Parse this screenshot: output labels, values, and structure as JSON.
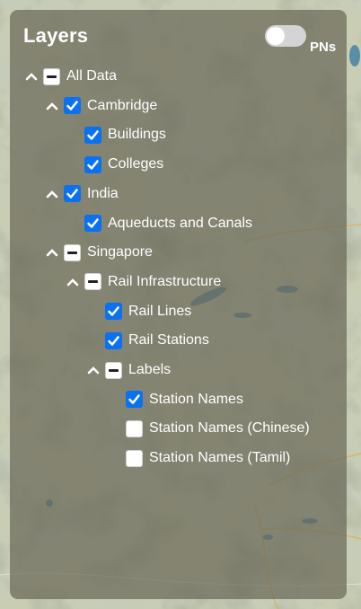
{
  "panel": {
    "title": "Layers",
    "pn_toggle": {
      "label": "PNs",
      "on": false
    }
  },
  "colors": {
    "checkbox_checked": "#0a72f0",
    "panel_background": "rgba(105,104,88,0.72)",
    "text": "#ffffff"
  },
  "layers": [
    {
      "id": "all-data",
      "label": "All Data",
      "state": "partial",
      "expanded": true,
      "depth": 0
    },
    {
      "id": "cambridge",
      "label": "Cambridge",
      "state": "checked",
      "expanded": true,
      "depth": 1
    },
    {
      "id": "buildings",
      "label": "Buildings",
      "state": "checked",
      "depth": 2
    },
    {
      "id": "colleges",
      "label": "Colleges",
      "state": "checked",
      "depth": 2
    },
    {
      "id": "india",
      "label": "India",
      "state": "checked",
      "expanded": true,
      "depth": 1
    },
    {
      "id": "aqueducts",
      "label": "Aqueducts and Canals",
      "state": "checked",
      "depth": 2
    },
    {
      "id": "singapore",
      "label": "Singapore",
      "state": "partial",
      "expanded": true,
      "depth": 1
    },
    {
      "id": "rail-infra",
      "label": "Rail Infrastructure",
      "state": "partial",
      "expanded": true,
      "depth": 2
    },
    {
      "id": "rail-lines",
      "label": "Rail Lines",
      "state": "checked",
      "depth": 3
    },
    {
      "id": "rail-stations",
      "label": "Rail Stations",
      "state": "checked",
      "depth": 3
    },
    {
      "id": "labels",
      "label": "Labels",
      "state": "partial",
      "expanded": true,
      "depth": 3
    },
    {
      "id": "station-names",
      "label": "Station Names",
      "state": "checked",
      "depth": 4
    },
    {
      "id": "station-names-chinese",
      "label": "Station Names (Chinese)",
      "state": "unchecked",
      "depth": 4
    },
    {
      "id": "station-names-tamil",
      "label": "Station Names (Tamil)",
      "state": "unchecked",
      "depth": 4
    }
  ]
}
